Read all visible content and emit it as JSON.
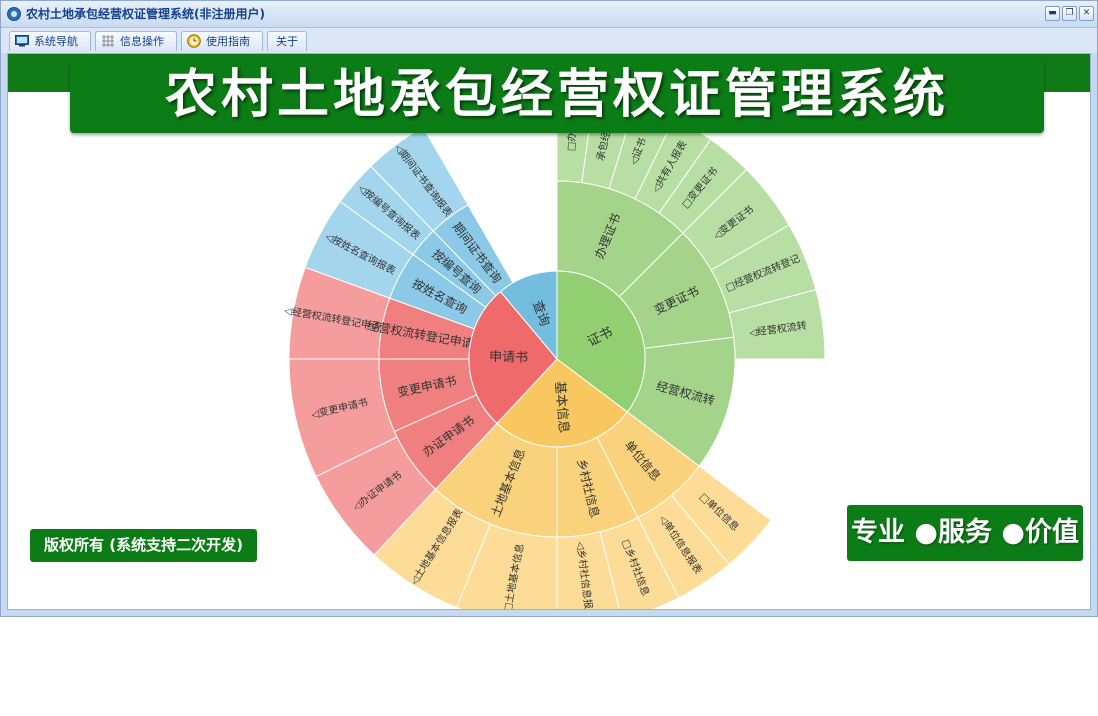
{
  "window": {
    "title": "农村土地承包经营权证管理系统(非注册用户)",
    "controls": {
      "minimize": "▬",
      "restore": "❐",
      "close": "✕"
    }
  },
  "tabs": [
    {
      "label": "系统导航",
      "icon": "monitor-icon"
    },
    {
      "label": "信息操作",
      "icon": "grid-icon"
    },
    {
      "label": "使用指南",
      "icon": "clock-icon"
    },
    {
      "label": "关于",
      "icon": ""
    }
  ],
  "banner": {
    "title": "农村土地承包经营权证管理系统"
  },
  "sunburst": {
    "center": [
      {
        "label": "证书",
        "color": "#92cf70"
      },
      {
        "label": "基本信息",
        "color": "#f9c75f"
      },
      {
        "label": "申请书",
        "color": "#ef6a6a"
      },
      {
        "label": "查询",
        "color": "#73bedf"
      }
    ],
    "middle": [
      {
        "label": "办理证书",
        "group": "证书",
        "color": "#a3d48a"
      },
      {
        "label": "变更证书",
        "group": "证书",
        "color": "#a3d48a"
      },
      {
        "label": "经营权流转",
        "group": "证书",
        "color": "#a3d48a"
      },
      {
        "label": "单位信息",
        "group": "基本信息",
        "color": "#fad27c"
      },
      {
        "label": "乡村社信息",
        "group": "基本信息",
        "color": "#fad27c"
      },
      {
        "label": "土地基本信息",
        "group": "基本信息",
        "color": "#fad27c"
      },
      {
        "label": "办证申请书",
        "group": "申请书",
        "color": "#f07f7f"
      },
      {
        "label": "变更申请书",
        "group": "申请书",
        "color": "#f07f7f"
      },
      {
        "label": "经营权流转登记申请书",
        "group": "申请书",
        "color": "#f07f7f"
      },
      {
        "label": "按姓名查询",
        "group": "查询",
        "color": "#8bc9e6"
      },
      {
        "label": "按编号查询",
        "group": "查询",
        "color": "#8bc9e6"
      },
      {
        "label": "期间证书查询",
        "group": "查询",
        "color": "#8bc9e6"
      }
    ],
    "outer": [
      {
        "label": "□办理",
        "color": "#b7dea3"
      },
      {
        "label": "承包经营",
        "color": "#b7dea3"
      },
      {
        "label": "◁证书",
        "color": "#b7dea3"
      },
      {
        "label": "◁共有人报表",
        "color": "#b7dea3"
      },
      {
        "label": "□变更证书",
        "color": "#b7dea3"
      },
      {
        "label": "◁变更证书",
        "color": "#b7dea3"
      },
      {
        "label": "□经营权流转登记",
        "color": "#b7dea3"
      },
      {
        "label": "◁经营权流转",
        "color": "#b7dea3"
      },
      {
        "label": "□单位信息",
        "color": "#fcdc97"
      },
      {
        "label": "◁单位信息报表",
        "color": "#fcdc97"
      },
      {
        "label": "□乡村社信息",
        "color": "#fcdc97"
      },
      {
        "label": "◁乡村社信息报表",
        "color": "#fcdc97"
      },
      {
        "label": "□土地基本信息",
        "color": "#fcdc97"
      },
      {
        "label": "◁土地基本信息报表",
        "color": "#fcdc97"
      },
      {
        "label": "◁办证申请书",
        "color": "#f59d9d"
      },
      {
        "label": "◁变更申请书",
        "color": "#f59d9d"
      },
      {
        "label": "◁经营权流转登记申请书",
        "color": "#f59d9d"
      },
      {
        "label": "◁按姓名查询报表",
        "color": "#a3d6ec"
      },
      {
        "label": "◁按编号查询报表",
        "color": "#a3d6ec"
      },
      {
        "label": "◁期间证书查询报表",
        "color": "#a3d6ec"
      }
    ]
  },
  "footer": {
    "copyright": "版权所有 (系统支持二次开发)",
    "slogan": "专业 ●服务 ●价值"
  }
}
